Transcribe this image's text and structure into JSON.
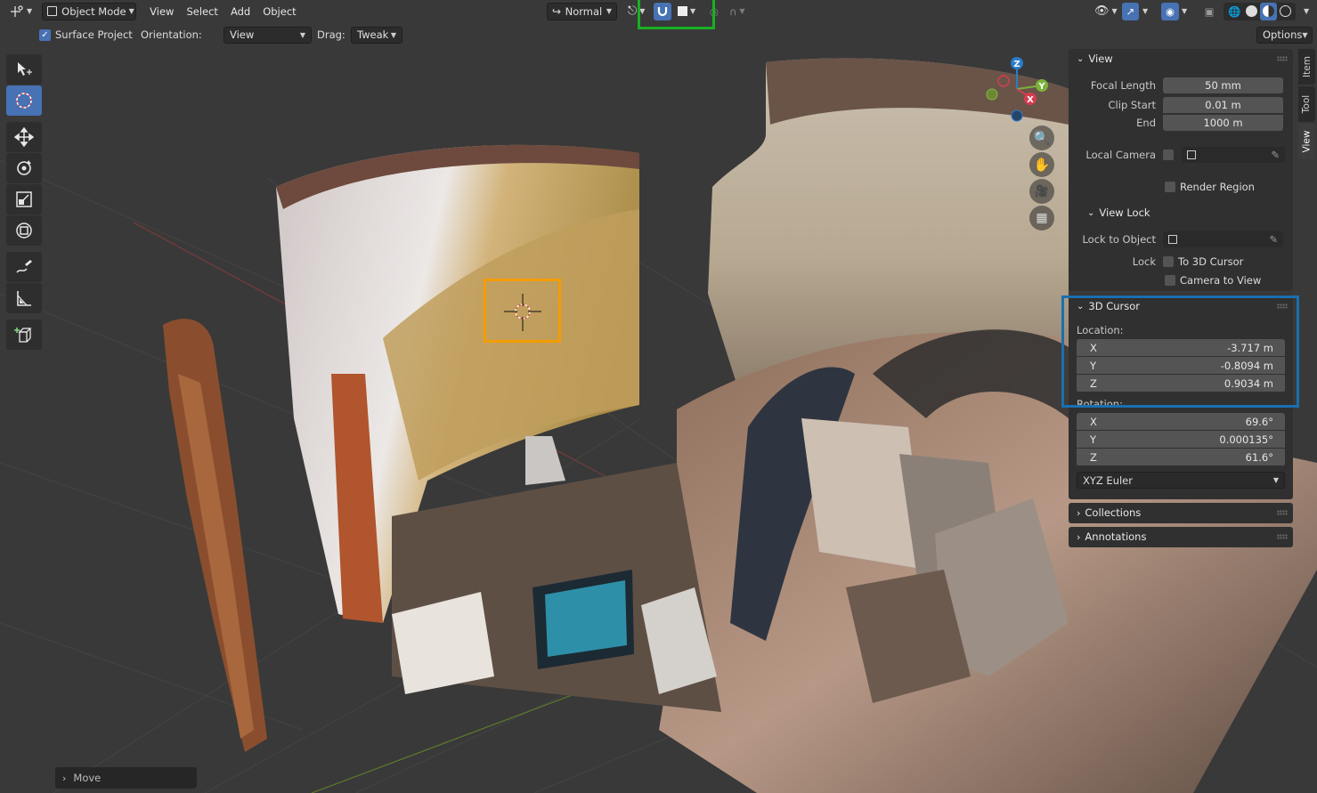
{
  "header": {
    "editor_type_icon": "editor-type-icon",
    "mode": "Object Mode",
    "menus": [
      "View",
      "Select",
      "Add",
      "Object"
    ],
    "transform_orientation": "Normal",
    "snap_target_icon": "square-icon"
  },
  "tool_settings": {
    "surface_project_label": "Surface Project",
    "surface_project_checked": true,
    "orientation_label": "Orientation:",
    "orientation_value": "View",
    "drag_label": "Drag:",
    "drag_value": "Tweak",
    "options_label": "Options"
  },
  "toolbar": {
    "tools": [
      "select-box",
      "cursor",
      "move",
      "rotate",
      "scale",
      "transform",
      "annotate",
      "measure",
      "add-cube"
    ],
    "selected": "cursor"
  },
  "side_tabs": [
    "Item",
    "Tool",
    "View"
  ],
  "active_side_tab": "View",
  "sidebar": {
    "view_panel": {
      "title": "View",
      "focal_length_label": "Focal Length",
      "focal_length": "50 mm",
      "clip_start_label": "Clip Start",
      "clip_start": "0.01 m",
      "clip_end_label": "End",
      "clip_end": "1000 m",
      "local_camera_label": "Local Camera",
      "render_region_label": "Render Region",
      "view_lock_title": "View Lock",
      "lock_to_object_label": "Lock to Object",
      "lock_label": "Lock",
      "to_3d_cursor_label": "To 3D Cursor",
      "camera_to_view_label": "Camera to View"
    },
    "cursor_panel": {
      "title": "3D Cursor",
      "location_label": "Location:",
      "location": [
        {
          "axis": "X",
          "value": "-3.717 m"
        },
        {
          "axis": "Y",
          "value": "-0.8094 m"
        },
        {
          "axis": "Z",
          "value": "0.9034 m"
        }
      ],
      "rotation_label": "Rotation:",
      "rotation": [
        {
          "axis": "X",
          "value": "69.6°"
        },
        {
          "axis": "Y",
          "value": "0.000135°"
        },
        {
          "axis": "Z",
          "value": "61.6°"
        }
      ],
      "rotation_mode": "XYZ Euler"
    },
    "collections_title": "Collections",
    "annotations_title": "Annotations"
  },
  "gizmo": {
    "z": "Z",
    "y": "Y",
    "x": "X"
  },
  "last_operator": "Move",
  "colors": {
    "accent": "#4772b3",
    "highlight_green": "#19b023",
    "highlight_orange": "#f59c00",
    "highlight_blue": "#1a6fb0"
  }
}
